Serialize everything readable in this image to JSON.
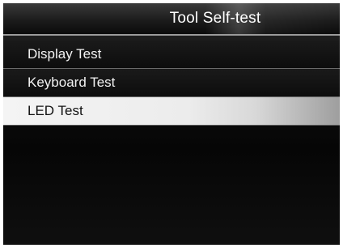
{
  "header": {
    "title": "Tool Self-test"
  },
  "menu": {
    "items": [
      {
        "label": "Display Test",
        "selected": false
      },
      {
        "label": "Keyboard Test",
        "selected": false
      },
      {
        "label": "LED Test",
        "selected": true
      }
    ]
  },
  "colors": {
    "background": "#0a0a0a",
    "selected_background": "#f0f0f0",
    "text": "#ffffff",
    "selected_text": "#111111"
  }
}
